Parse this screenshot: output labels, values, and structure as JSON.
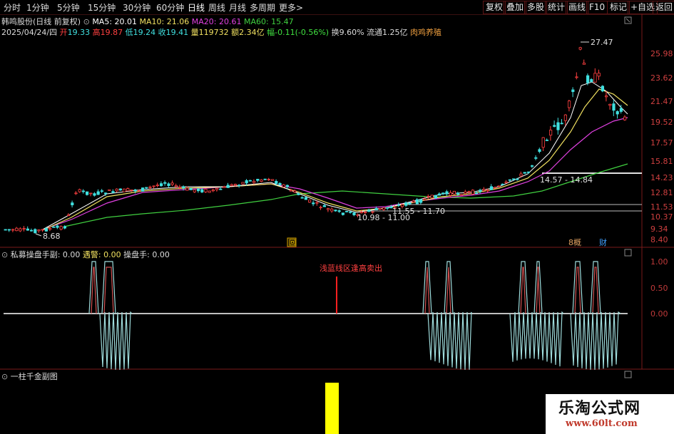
{
  "toolbar": {
    "periods": [
      "分时",
      "1分钟",
      "5分钟",
      "15分钟",
      "30分钟",
      "60分钟",
      "日线",
      "周线",
      "月线",
      "多周期",
      "更多"
    ],
    "more_arrow": ">",
    "buttons": [
      "复权",
      "叠加",
      "多股",
      "统计",
      "画线",
      "F10",
      "标记",
      "+自选",
      "返回"
    ],
    "active_period": "日线"
  },
  "stock": {
    "title": "韩鸣股份(日线 前复权)",
    "ma5": "MA5: 20.01",
    "ma10": "MA10: 21.06",
    "ma20": "MA20: 20.61",
    "ma60": "MA60: 15.47",
    "date": "2025/04/24/四",
    "open_label": "开",
    "open": "19.33",
    "high_label": "高",
    "high": "19.87",
    "low_label": "低",
    "low": "19.24",
    "close_label": "收",
    "close": "19.41",
    "volume_label": "量",
    "volume": "119732",
    "amount_label": "额",
    "amount": "2.34亿",
    "change_label": "幅",
    "change": "-0.11(-0.56%)",
    "turnover": "换9.60%",
    "float_cap": "流通1.25亿",
    "industry": "肉鸡养殖"
  },
  "main_chart": {
    "price_axis": [
      "25.98",
      "23.62",
      "21.47",
      "19.52",
      "17.57",
      "15.81",
      "14.23",
      "12.81",
      "11.53",
      "10.37",
      "9.34",
      "8.40"
    ],
    "annotations": {
      "high": "27.47",
      "low": "8.68",
      "range1": "10.98 - 11.00",
      "range2": "11.55 - 11.70",
      "range3": "14.57 - 14.84"
    },
    "markers": [
      "回",
      "8概",
      "财"
    ],
    "colors": {
      "ma5": "#ffffff",
      "ma10": "#f0e060",
      "ma20": "#e040e0",
      "ma60": "#40d040",
      "up": "#ff4040",
      "down": "#40e0e0"
    }
  },
  "indicator1": {
    "title": "私募操盘手副",
    "v1": ": 0.00",
    "alert_label": "遇警",
    "alert_value": ": 0.00",
    "trader_label": "操盘手",
    "trader_value": ": 0.00",
    "axis": [
      "1.00",
      "0.50",
      "0.00"
    ],
    "note": "浅蓝线区逢高卖出"
  },
  "indicator2": {
    "title": "一柱千金副图"
  },
  "watermark": {
    "name": "乐淘公式网",
    "url": "www.60lt.com"
  }
}
